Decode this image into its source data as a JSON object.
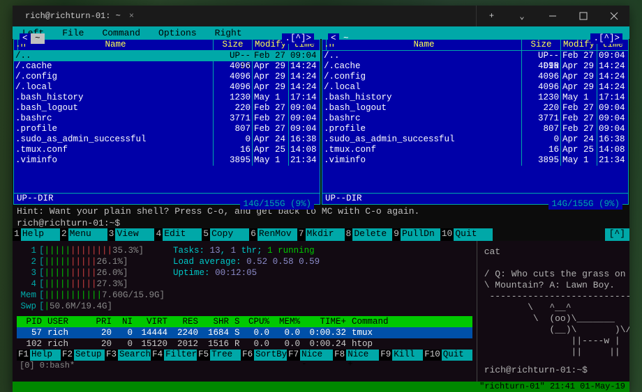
{
  "titlebar": {
    "tab_title": "rich@richturn-01: ~",
    "close_glyph": "×",
    "add_glyph": "+",
    "chev_glyph": "⌄"
  },
  "mc": {
    "menu": [
      "Left",
      "File",
      "Command",
      "Options",
      "Right"
    ],
    "panel_head_left": "<",
    "panel_head_tilde": "~",
    "panel_head_arrow": ".[^]>",
    "columns": {
      "n": ".n",
      "name": "Name",
      "size": "Size",
      "mod": "Modify",
      "time": "time"
    },
    "rows": [
      {
        "name": "/..",
        "size": "UP--DIR",
        "mod": "Feb 27",
        "time": "09:04",
        "selected": true
      },
      {
        "name": "/.cache",
        "size": "4096",
        "mod": "Apr 29",
        "time": "14:24"
      },
      {
        "name": "/.config",
        "size": "4096",
        "mod": "Apr 29",
        "time": "14:24"
      },
      {
        "name": "/.local",
        "size": "4096",
        "mod": "Apr 29",
        "time": "14:24"
      },
      {
        "name": ".bash_history",
        "size": "1230",
        "mod": "May  1",
        "time": "17:14"
      },
      {
        "name": ".bash_logout",
        "size": "220",
        "mod": "Feb 27",
        "time": "09:04"
      },
      {
        "name": ".bashrc",
        "size": "3771",
        "mod": "Feb 27",
        "time": "09:04"
      },
      {
        "name": ".profile",
        "size": "807",
        "mod": "Feb 27",
        "time": "09:04"
      },
      {
        "name": ".sudo_as_admin_successful",
        "size": "0",
        "mod": "Apr 24",
        "time": "16:38"
      },
      {
        "name": ".tmux.conf",
        "size": "16",
        "mod": "Apr 25",
        "time": "14:08"
      },
      {
        "name": ".viminfo",
        "size": "3895",
        "mod": "May  1",
        "time": "21:34"
      }
    ],
    "panel_footer": "UP--DIR",
    "panel_status": "14G/155G (9%)",
    "hint": "Hint: Want your plain shell? Press C-o, and get back to MC with C-o again.",
    "prompt": "rich@richturn-01:~$",
    "caret": "[^]",
    "fkeys": [
      {
        "n": "1",
        "l": "Help"
      },
      {
        "n": "2",
        "l": "Menu"
      },
      {
        "n": "3",
        "l": "View"
      },
      {
        "n": "4",
        "l": "Edit"
      },
      {
        "n": "5",
        "l": "Copy"
      },
      {
        "n": "6",
        "l": "RenMov"
      },
      {
        "n": "7",
        "l": "Mkdir"
      },
      {
        "n": "8",
        "l": "Delete"
      },
      {
        "n": "9",
        "l": "PullDn"
      },
      {
        "n": "10",
        "l": "Quit"
      }
    ]
  },
  "htop": {
    "cpus": [
      {
        "lbl": "1",
        "bar_g": 5,
        "bar_r": 8,
        "pct": "35.3%"
      },
      {
        "lbl": "2",
        "bar_g": 5,
        "bar_r": 5,
        "pct": "26.1%"
      },
      {
        "lbl": "3",
        "bar_g": 5,
        "bar_r": 5,
        "pct": "26.0%"
      },
      {
        "lbl": "4",
        "bar_g": 5,
        "bar_r": 5,
        "pct": "27.3%"
      }
    ],
    "mem": {
      "lbl": "Mem",
      "bar": "|||||||||||",
      "val": "7.60G/15.9G"
    },
    "swp": {
      "lbl": "Swp",
      "bar": "|",
      "val": "50.6M/19.4G"
    },
    "stats": {
      "tasks": "Tasks: 13, 1 thr; 1 running",
      "tasks_pre": "Tasks: ",
      "tasks_n": "13",
      "tasks_mid": ", ",
      "tasks_thr": "1",
      "tasks_suf": " thr; ",
      "tasks_run": "1 running",
      "load": "Load average: 0.52 0.58 0.59",
      "load_pre": "Load average: ",
      "load_v": "0.52 0.58 0.59",
      "uptime": "Uptime: 00:12:05",
      "up_pre": "Uptime: ",
      "up_v": "00:12:05"
    },
    "headers": [
      "PID",
      "USER",
      "PRI",
      "NI",
      "VIRT",
      "RES",
      "SHR",
      "S",
      "CPU%",
      "MEM%",
      "TIME+",
      "Command"
    ],
    "rows": [
      {
        "pid": "57",
        "user": "rich",
        "pri": "20",
        "ni": "0",
        "virt": "14444",
        "res": "2240",
        "shr": "1684",
        "s": "S",
        "cpu": "0.0",
        "mem": "0.0",
        "time": "0:00.32",
        "cmd": "tmux",
        "sel": true
      },
      {
        "pid": "102",
        "user": "rich",
        "pri": "20",
        "ni": "0",
        "virt": "15120",
        "res": "2012",
        "shr": "1516",
        "s": "R",
        "cpu": "0.0",
        "mem": "0.0",
        "time": "0:00.24",
        "cmd": "htop"
      }
    ],
    "fkeys": [
      {
        "n": "F1",
        "l": "Help"
      },
      {
        "n": "F2",
        "l": "Setup"
      },
      {
        "n": "F3",
        "l": "Search"
      },
      {
        "n": "F4",
        "l": "Filter"
      },
      {
        "n": "F5",
        "l": "Tree"
      },
      {
        "n": "F6",
        "l": "SortBy"
      },
      {
        "n": "F7",
        "l": "Nice -"
      },
      {
        "n": "F8",
        "l": "Nice +"
      },
      {
        "n": "F9",
        "l": "Kill"
      },
      {
        "n": "F10",
        "l": "Quit"
      }
    ],
    "cutline": "[0] 0:bash*"
  },
  "cow": {
    "cmd": "cat",
    "line1": "/ Q: Who cuts the grass on Walton's \\",
    "line2": "\\ Mountain? A: Lawn Boy.             /",
    "dash": " ----------------------------------- ",
    "art": "        \\   ^__^\n         \\  (oo)\\_______\n            (__)\\       )\\/\\\n                ||----w |\n                ||     ||",
    "prompt": "rich@richturn-01:~$"
  },
  "tmux_status": "\"richturn-01\" 21:41 01-May-19"
}
